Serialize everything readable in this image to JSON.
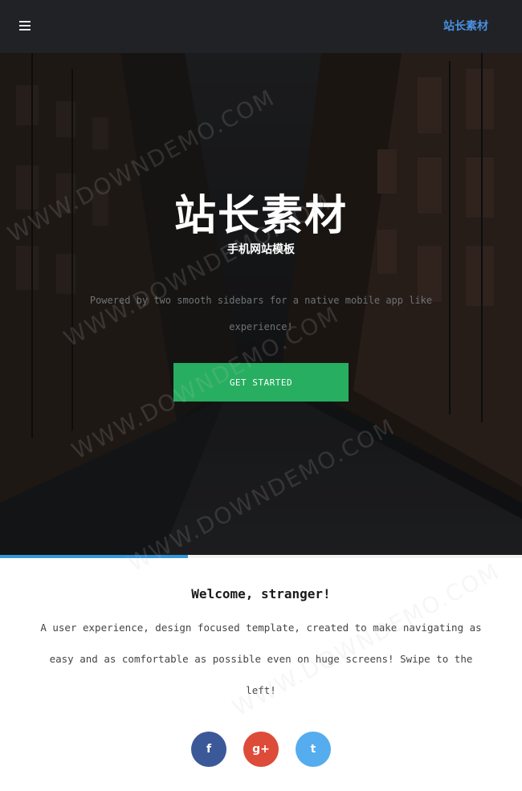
{
  "header": {
    "brand": "站长素材",
    "menu_icon": "hamburger-icon"
  },
  "hero": {
    "title": "站长素材",
    "subtitle": "手机网站模板",
    "description": "Powered by two smooth sidebars for a native mobile app like experience!",
    "cta_label": "GET STARTED"
  },
  "progress": {
    "percent": 36
  },
  "welcome": {
    "title": "Welcome, stranger!",
    "text": "A user experience, design focused template, created to make navigating as easy and as comfortable as possible even on huge screens! Swipe to the left!"
  },
  "social": [
    {
      "icon": "facebook-icon",
      "glyph": "f",
      "color": "#3b5998"
    },
    {
      "icon": "google-plus-icon",
      "glyph": "g+",
      "color": "#dd4b39"
    },
    {
      "icon": "twitter-icon",
      "glyph": "t",
      "color": "#55acee"
    }
  ],
  "watermark": "WWW.DOWNDEMO.COM",
  "colors": {
    "accent": "#27ae60",
    "brand": "#4a90e2",
    "progress": "#3498db"
  }
}
